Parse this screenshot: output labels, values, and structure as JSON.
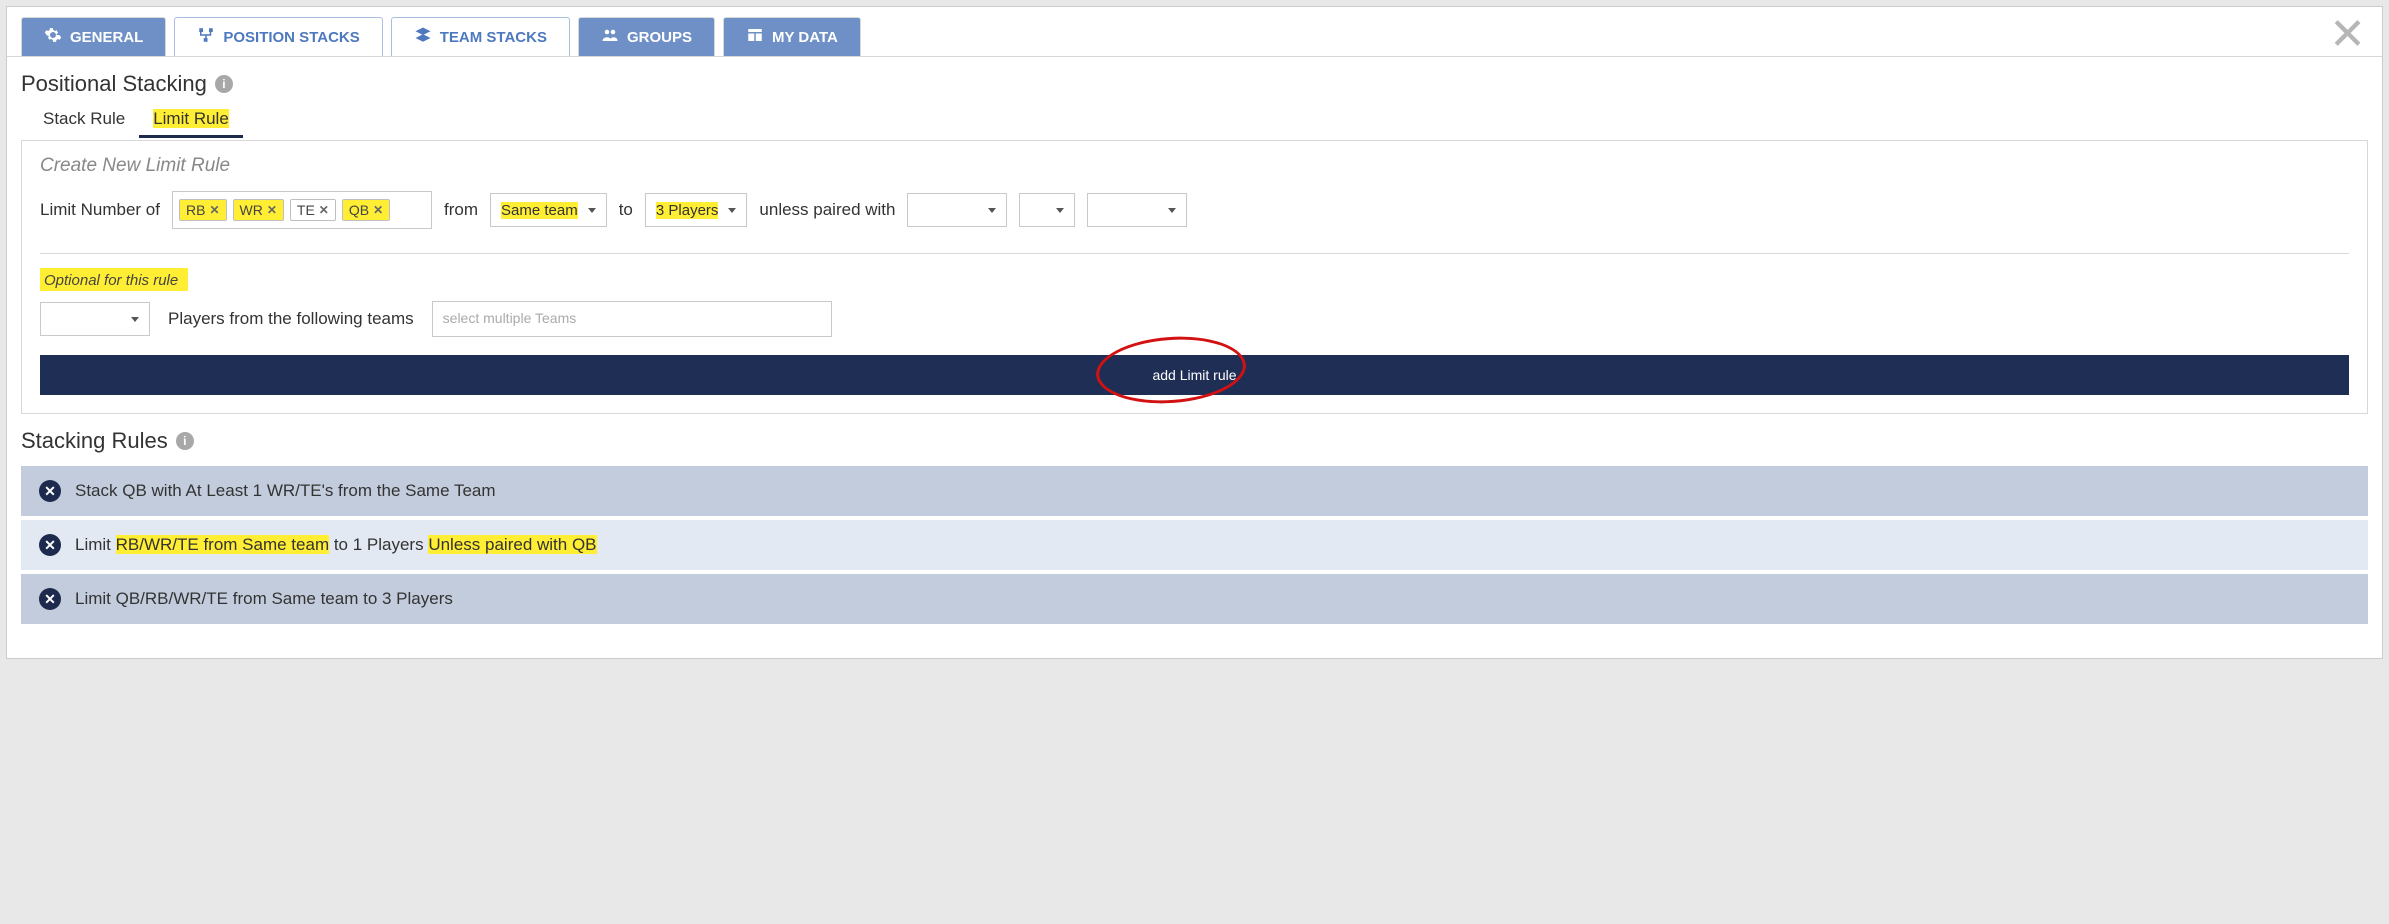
{
  "tabs": {
    "general": "GENERAL",
    "position": "POSITION STACKS",
    "team": "TEAM STACKS",
    "groups": "GROUPS",
    "mydata": "MY DATA"
  },
  "section_title": "Positional Stacking",
  "subtabs": {
    "stack": "Stack Rule",
    "limit": "Limit Rule"
  },
  "form": {
    "heading": "Create New Limit Rule",
    "limit_label": "Limit Number of",
    "chips": {
      "rb": "RB",
      "wr": "WR",
      "te": "TE",
      "qb": "QB"
    },
    "from_label": "from",
    "from_value": "Same team",
    "to_label": "to",
    "to_value": "3 Players",
    "unless_label": "unless paired with",
    "optional_label": "Optional for this rule",
    "players_label": "Players from the following teams",
    "teams_placeholder": "select multiple Teams",
    "add_btn": "add Limit rule"
  },
  "rules_title": "Stacking Rules",
  "rules": {
    "r0": "Stack QB with At Least 1 WR/TE's from the Same Team",
    "r1_a": "Limit ",
    "r1_b": "RB/WR/TE from Same team",
    "r1_c": " to 1 Players ",
    "r1_d": "Unless paired with QB",
    "r2": "Limit QB/RB/WR/TE from Same team to 3 Players"
  }
}
